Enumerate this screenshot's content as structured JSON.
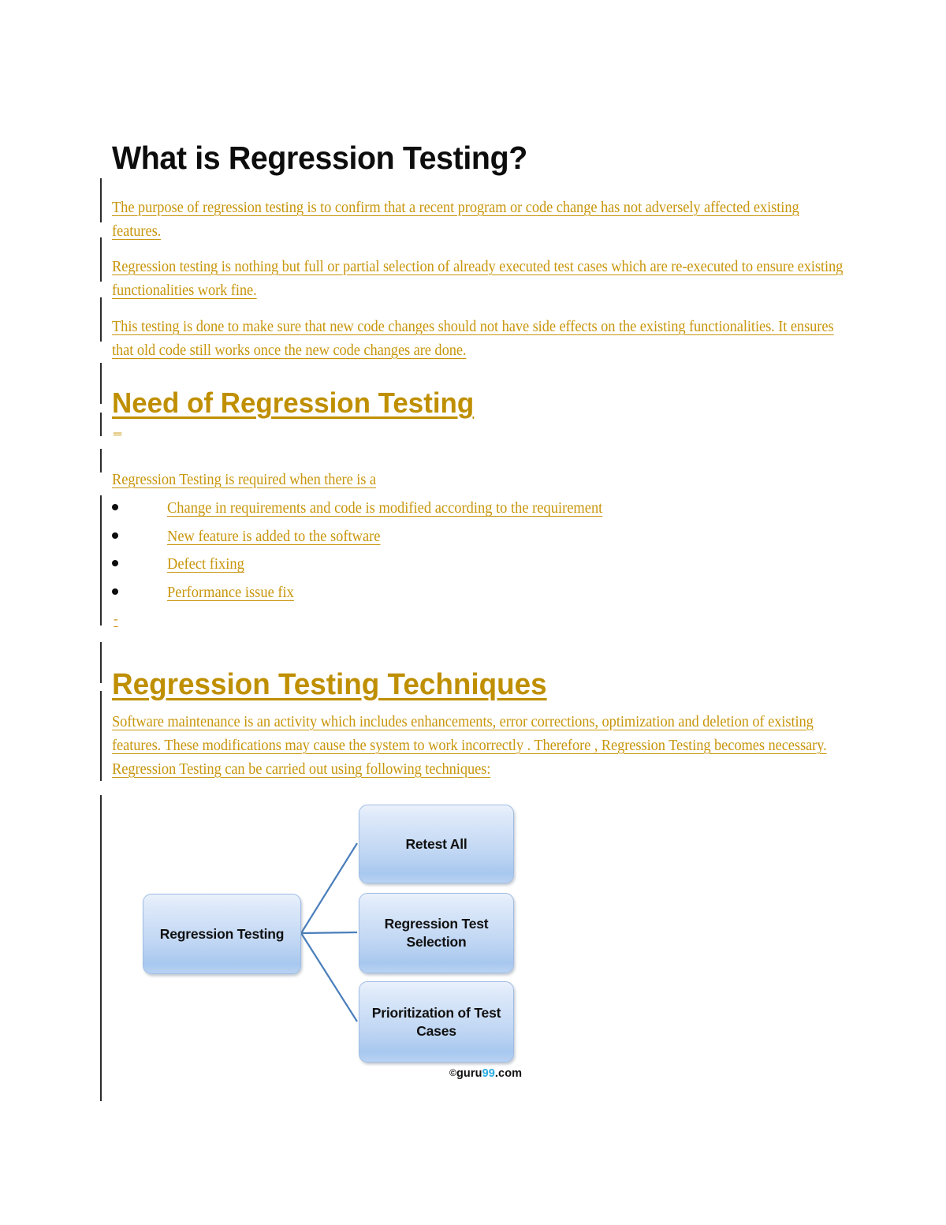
{
  "document": {
    "title": "What is Regression Testing?",
    "paragraphs": {
      "intro_1": "The purpose of regression testing is to confirm that a  recent program or code change has not adversely affected existing features.",
      "intro_2": "Regression testing is nothing but full or partial selection of already executed test cases which are re-executed to ensure existing functionalities work fine.",
      "intro_3": "This testing is done to make sure that new code changes should not have side effects on the existing functionalities. It  ensures that old code still works once  the new code changes are done.",
      "need_intro": "Regression Testing is required when there is a",
      "techniques_intro": "Software maintenance is an activity which includes enhancements, error corrections, optimization and deletion of existing features. These modifications may cause the system to work incorrectly . Therefore , Regression Testing becomes necessary. Regression Testing can be carried out using following techniques:"
    },
    "headings": {
      "need": "Need of Regression Testing",
      "techniques": "Regression Testing Techniques"
    },
    "dashes": {
      "after_need_heading": "_",
      "after_bullet_list": "-"
    },
    "bullets": [
      "Change in requirements and code is modified according to the requirement",
      "New feature is added to the software",
      "Defect fixing",
      "Performance issue fix "
    ]
  },
  "diagram": {
    "root_label": "Regression Testing",
    "branches": [
      "Retest All",
      "Regression Test Selection",
      "Prioritization of Test Cases"
    ],
    "watermark": {
      "copyright": "©",
      "name": "guru",
      "number": "99",
      "tld": ".com"
    }
  },
  "colors": {
    "heading_gold": "#BF8F00",
    "body_gold": "#C8960C",
    "title_black": "#0D0D0D",
    "connector_blue": "#4A7EBB",
    "node_border": "#9FBDE4",
    "logo_blue": "#29ABE2"
  }
}
